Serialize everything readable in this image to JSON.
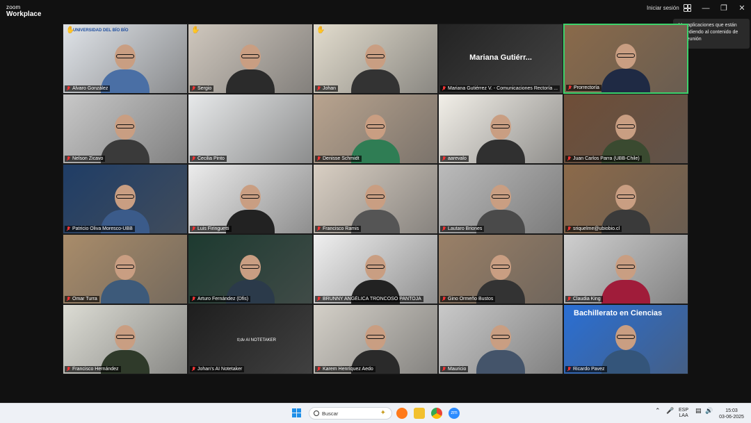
{
  "app": {
    "brand_top": "zoom",
    "brand_bottom": "Workplace",
    "signin": "Iniciar sesión"
  },
  "tooltip": {
    "text": "Ver aplicaciones que están accediendo al contenido de su reunión"
  },
  "tiles": [
    {
      "name": "Alvaro González",
      "bg": "#dfe3e8",
      "shirt": "#4a6fa5",
      "hand": true,
      "overlay": "UNIVERSIDAD DEL BÍO BÍO"
    },
    {
      "name": "Sergio",
      "bg": "#cfc7bd",
      "shirt": "#2b2b2b",
      "hand": true
    },
    {
      "name": "Johan",
      "bg": "#e2dccd",
      "shirt": "#333333",
      "hand": true
    },
    {
      "name": "Mariana Gutiérrez V. - Comunicaciones Rectoría ...",
      "bg": "#232323",
      "shirt": "",
      "big": "Mariana  Gutiérr..."
    },
    {
      "name": "Prorrectoría",
      "bg": "#8a6a4a",
      "shirt": "#1f2a44",
      "active": true
    },
    {
      "name": "Nelson Zicavo",
      "bg": "#c8c8c8",
      "shirt": "#3a3a3a"
    },
    {
      "name": "Cecilia Pinto",
      "bg": "#e7e9ea",
      "shirt": ""
    },
    {
      "name": "Denisse Schmidt",
      "bg": "#b9a48f",
      "shirt": "#2f7d54"
    },
    {
      "name": "aarevalo",
      "bg": "#f2efe8",
      "shirt": "#303030"
    },
    {
      "name": "Juan Carlos Parra (UBB-Chile)",
      "bg": "#6f4e37",
      "shirt": "#3a4a30"
    },
    {
      "name": "Patricio Oliva Moresco-UBB",
      "bg": "#1f3d66",
      "shirt": "#3b5b8a"
    },
    {
      "name": "Luis Firinguetti",
      "bg": "#ececec",
      "shirt": "#222222"
    },
    {
      "name": "Francisco Ramis",
      "bg": "#d9cfc3",
      "shirt": "#555555"
    },
    {
      "name": "Lautaro Briones",
      "bg": "#bbbbbb",
      "shirt": "#4a4a4a"
    },
    {
      "name": "sriquelme@ubiobio.cl",
      "bg": "#8c6a4a",
      "shirt": "#3a3a3a"
    },
    {
      "name": "Omar Turra",
      "bg": "#a98c6a",
      "shirt": "#3d5a7a"
    },
    {
      "name": "Arturo Fernández (Dfis)",
      "bg": "#1d3a30",
      "shirt": "#2b3a4a"
    },
    {
      "name": "BRUNNY ANGÉLICA TRONCOSO PANTOJA",
      "bg": "#f0f0f0",
      "shirt": "#222222"
    },
    {
      "name": "Gino Ormeño Bustos",
      "bg": "#9a8067",
      "shirt": "#333333"
    },
    {
      "name": "Claudia King",
      "bg": "#cfcfcf",
      "shirt": "#a01c3a"
    },
    {
      "name": "Francisco Hernández",
      "bg": "#dcdcd4",
      "shirt": "#2f3a2a"
    },
    {
      "name": "Johan's AI Notetaker",
      "bg": "#1e1e1e",
      "shirt": "",
      "small": "tl;dv  AI NOTETAKER"
    },
    {
      "name": "Karem Henríquez Aedo",
      "bg": "#d4d0c8",
      "shirt": "#2a2a2a"
    },
    {
      "name": "Mauricio",
      "bg": "#c9c9c9",
      "shirt": "#44546a"
    },
    {
      "name": "Ricardo Pavez",
      "bg": "#2a6fd4",
      "shirt": "#34557a",
      "banner": "Bachillerato en Ciencias"
    }
  ],
  "taskbar": {
    "search_placeholder": "Buscar",
    "lang_top": "ESP",
    "lang_bottom": "LAA",
    "time": "15:03",
    "date": "03-06-2025"
  },
  "colors": {
    "active_border": "#3dd36c",
    "mic_muted": "#e33333"
  }
}
